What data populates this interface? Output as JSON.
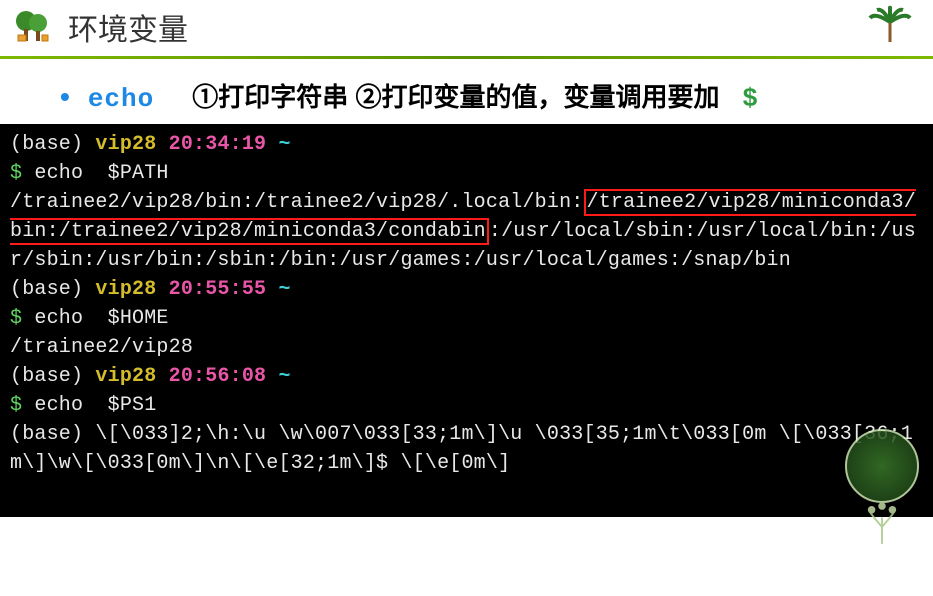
{
  "header": {
    "title": "环境变量"
  },
  "subtitle": {
    "bullet": "•",
    "command": "echo",
    "desc_prefix": "①打印字符串 ②打印变量的值，变量调用要加",
    "dollar": "$"
  },
  "terminal": {
    "p1_base": "(base) ",
    "p1_user": "vip28 ",
    "p1_time": "20:34:19 ",
    "p1_tilde": "~",
    "cmd1_prompt": "$ ",
    "cmd1": "echo  $PATH",
    "path_seg1": "/trainee2/vip28/bin:/trainee2/vip28/.local/bin:",
    "path_box": "/trainee2/vip28/miniconda3/bin:/trainee2/vip28/miniconda3/condabin",
    "path_seg2": ":/usr/local/sbin:/usr/local/bin:/usr/sbin:/usr/bin:/sbin:/bin:/usr/games:/usr/local/games:/snap/bin",
    "p2_base": "(base) ",
    "p2_user": "vip28 ",
    "p2_time": "20:55:55 ",
    "p2_tilde": "~",
    "cmd2_prompt": "$ ",
    "cmd2": "echo  $HOME",
    "out2": "/trainee2/vip28",
    "p3_base": "(base) ",
    "p3_user": "vip28 ",
    "p3_time": "20:56:08 ",
    "p3_tilde": "~",
    "cmd3_prompt": "$ ",
    "cmd3": "echo  $PS1",
    "out3": "(base) \\[\\033]2;\\h:\\u \\w\\007\\033[33;1m\\]\\u \\033[35;1m\\t\\033[0m \\[\\033[36;1m\\]\\w\\[\\033[0m\\]\\n\\[\\e[32;1m\\]$ \\[\\e[0m\\]"
  }
}
